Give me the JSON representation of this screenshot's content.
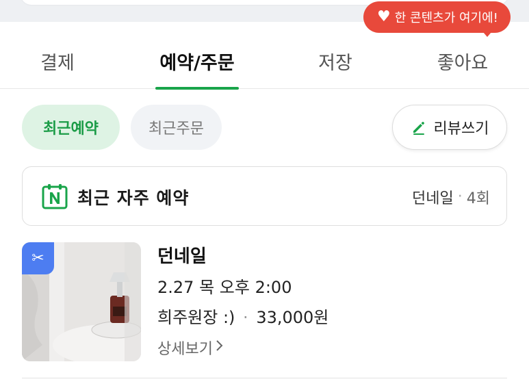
{
  "promo": {
    "text": "한 콘텐츠가 여기에!",
    "icon": "heart-icon",
    "color": "#e8493b"
  },
  "tabs": [
    {
      "label": "결제",
      "active": false
    },
    {
      "label": "예약/주문",
      "active": true
    },
    {
      "label": "저장",
      "active": false
    },
    {
      "label": "좋아요",
      "active": false
    }
  ],
  "filters": {
    "recent_reservation": "최근예약",
    "recent_order": "최근주문",
    "active": "최근예약"
  },
  "review_button": {
    "label": "리뷰쓰기",
    "icon": "pencil-icon"
  },
  "frequent": {
    "icon": "naver-calendar-icon",
    "title": "최근 자주 예약",
    "place": "던네일",
    "separator": "·",
    "count": "4회"
  },
  "reservation": {
    "name": "던네일",
    "datetime": "2.27 목 오후 2:00",
    "option": "희주원장 :)",
    "separator": "·",
    "price": "33,000원",
    "detail_link": "상세보기",
    "badge_icon": "scissors-icon"
  },
  "colors": {
    "accent": "#19a44a",
    "chip_bg": "#def3e4",
    "badge": "#4d7df1"
  }
}
